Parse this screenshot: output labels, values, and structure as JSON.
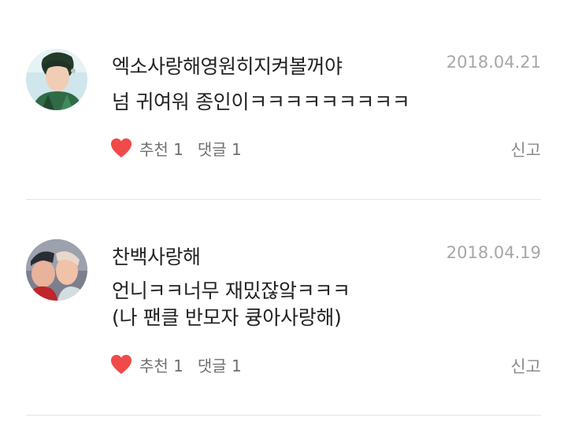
{
  "comments": [
    {
      "author": "엑소사랑해영원히지켜볼꺼야",
      "date": "2018.04.21",
      "body": [
        "넘 귀여워 종인이ㅋㅋㅋㅋㅋㅋㅋㅋㅋ"
      ],
      "likes_label": "추천 1",
      "replies_label": "댓글 1",
      "report_label": "신고",
      "avatar_icon": "profile-photo-avatar"
    },
    {
      "author": "찬백사랑해",
      "date": "2018.04.19",
      "body": [
        "언니ㅋㅋ너무 재밌잖앜ㅋㅋㅋ",
        "(나 팬클 반모자 큥아사랑해)"
      ],
      "likes_label": "추천 1",
      "replies_label": "댓글 1",
      "report_label": "신고",
      "avatar_icon": "profile-photo-avatar"
    }
  ],
  "colors": {
    "heart": "#f04a4a",
    "text_primary": "#222222",
    "text_secondary": "#6f6f6f",
    "date": "#a7a7a7",
    "divider": "#e4e4e4"
  },
  "icons": {
    "like": "heart-icon"
  }
}
